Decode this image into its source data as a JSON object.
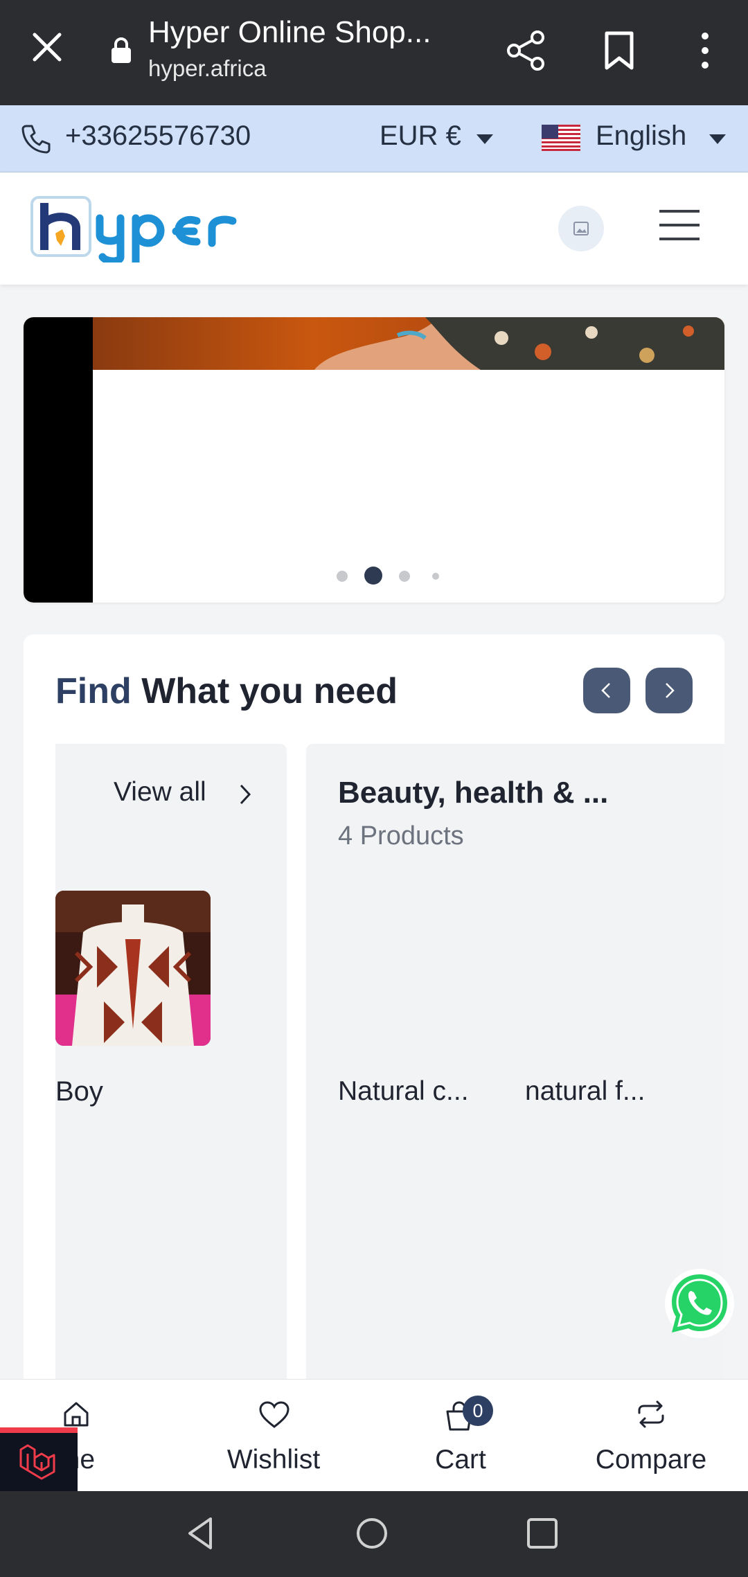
{
  "browser": {
    "tab_title": "Hyper Online Shop...",
    "url": "hyper.africa",
    "icons": [
      "close-icon",
      "lock-icon",
      "share-icon",
      "bookmark-icon",
      "more-vert-icon"
    ]
  },
  "topbar": {
    "phone": "+33625576730",
    "currency": "EUR €",
    "language": "English",
    "icons": [
      "phone-icon",
      "us-flag-icon",
      "caret-down-icon"
    ]
  },
  "header": {
    "logo_text": "hyper",
    "icons": [
      "image-icon",
      "hamburger-menu-icon"
    ]
  },
  "carousel": {
    "slides_count": 4,
    "active_index": 1
  },
  "categories": {
    "title_accent": "Find",
    "title_rest": "What you need",
    "view_all": "View all",
    "cards": [
      {
        "name": "",
        "items": [
          {
            "label": "Boy"
          }
        ]
      },
      {
        "name": "Beauty, health & ...",
        "count": "4 Products",
        "items": [
          {
            "label": "Natural c..."
          },
          {
            "label": "natural f..."
          }
        ]
      }
    ]
  },
  "bottom_nav": {
    "items": [
      {
        "label": "me",
        "icon": "home-icon"
      },
      {
        "label": "Wishlist",
        "icon": "heart-icon"
      },
      {
        "label": "Cart",
        "icon": "cart-icon"
      },
      {
        "label": "Compare",
        "icon": "compare-icon"
      }
    ],
    "cart_count": "0"
  },
  "colors": {
    "topbar_bg": "#cfe0f8",
    "accent": "#2d4063",
    "whatsapp": "#25d366",
    "chrome_bg": "#2c2d31"
  }
}
